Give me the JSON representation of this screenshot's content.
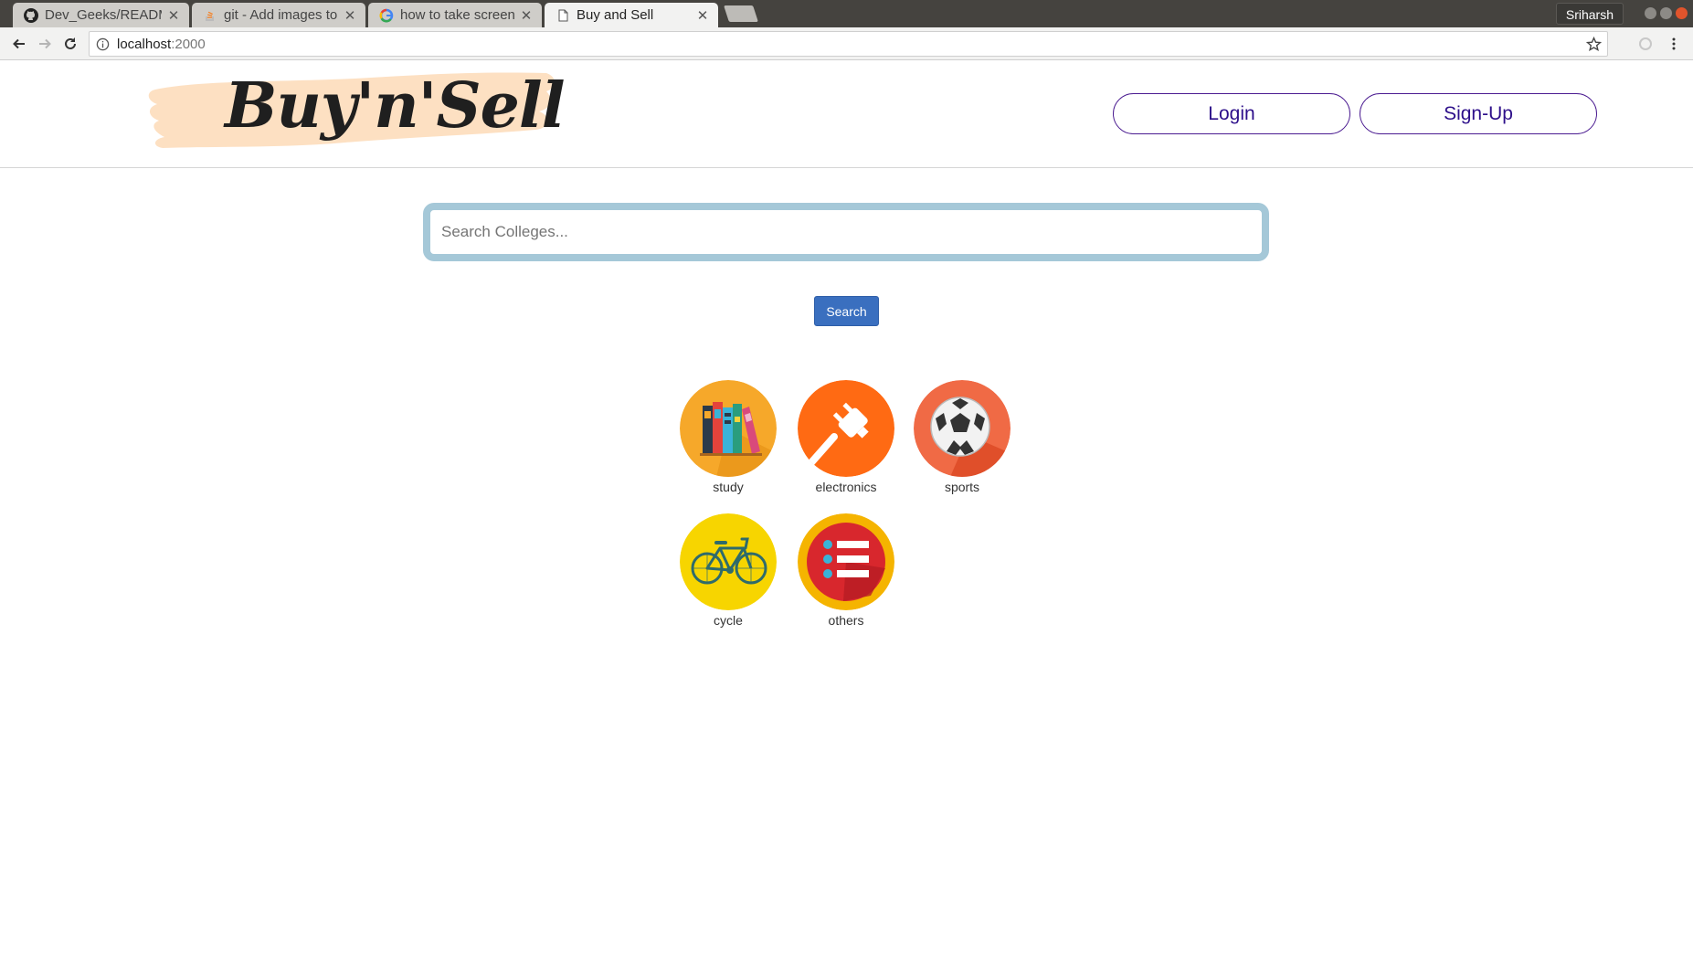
{
  "browser": {
    "tabs": [
      {
        "title": "Dev_Geeks/READM",
        "icon": "github-icon"
      },
      {
        "title": "git - Add images to",
        "icon": "stackoverflow-icon"
      },
      {
        "title": "how to take screens",
        "icon": "google-icon"
      },
      {
        "title": "Buy and Sell",
        "icon": "page-icon"
      }
    ],
    "profile": "Sriharsh",
    "url_host": "localhost",
    "url_port": ":2000"
  },
  "header": {
    "logo_text": "Buy'n'Sell",
    "login_label": "Login",
    "signup_label": "Sign-Up"
  },
  "search": {
    "placeholder": "Search Colleges...",
    "value": "",
    "button_label": "Search"
  },
  "categories": [
    {
      "label": "study",
      "icon": "books-icon",
      "color": "#f6a82a"
    },
    {
      "label": "electronics",
      "icon": "plug-icon",
      "color": "#ff6a13"
    },
    {
      "label": "sports",
      "icon": "soccer-ball-icon",
      "color": "#f06a45"
    },
    {
      "label": "cycle",
      "icon": "bicycle-icon",
      "color": "#f7d500"
    },
    {
      "label": "others",
      "icon": "list-icon",
      "color": "#f5b400"
    }
  ]
}
